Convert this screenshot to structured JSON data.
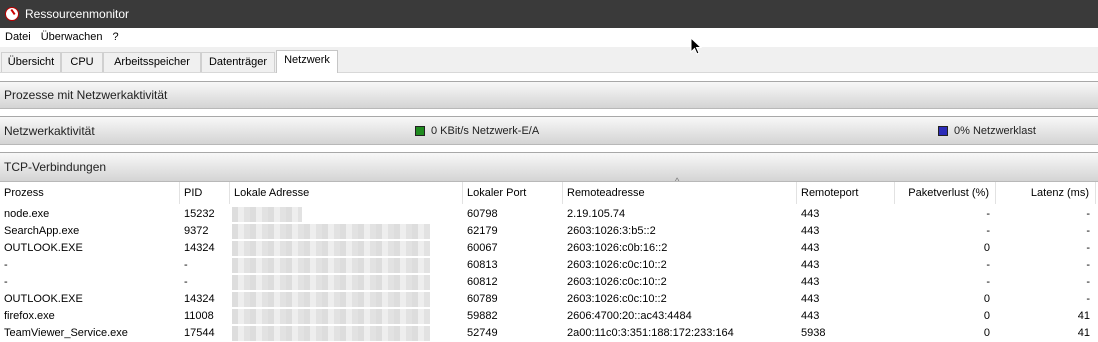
{
  "window": {
    "title": "Ressourcenmonitor",
    "icon": "resmon-gauge-icon"
  },
  "menu": [
    "Datei",
    "Überwachen",
    "?"
  ],
  "tabs": [
    {
      "label": "Übersicht",
      "active": false
    },
    {
      "label": "CPU",
      "active": false
    },
    {
      "label": "Arbeitsspeicher",
      "active": false
    },
    {
      "label": "Datenträger",
      "active": false
    },
    {
      "label": "Netzwerk",
      "active": true
    }
  ],
  "sections": {
    "processes": {
      "title": "Prozesse mit Netzwerkaktivität"
    },
    "activity": {
      "title": "Netzwerkaktivität",
      "io_text": "0 KBit/s Netzwerk-E/A",
      "io_color": "#1f8a1f",
      "load_text": "0% Netzwerklast",
      "load_color": "#2b2bb8"
    },
    "tcp": {
      "title": "TCP-Verbindungen"
    }
  },
  "tcp_table": {
    "columns": [
      "Prozess",
      "PID",
      "Lokale Adresse",
      "Lokaler Port",
      "Remoteadresse",
      "Remoteport",
      "Paketverlust (%)",
      "Latenz (ms)"
    ],
    "sorted_column": "Remoteadresse",
    "rows": [
      {
        "process": "node.exe",
        "pid": "15232",
        "local_port": "60798",
        "remote_address": "2.19.105.74",
        "remote_port": "443",
        "packet_loss": "-",
        "latency": "-"
      },
      {
        "process": "SearchApp.exe",
        "pid": "9372",
        "local_port": "62179",
        "remote_address": "2603:1026:3:b5::2",
        "remote_port": "443",
        "packet_loss": "-",
        "latency": "-"
      },
      {
        "process": "OUTLOOK.EXE",
        "pid": "14324",
        "local_port": "60067",
        "remote_address": "2603:1026:c0b:16::2",
        "remote_port": "443",
        "packet_loss": "0",
        "latency": "-"
      },
      {
        "process": "-",
        "pid": "-",
        "local_port": "60813",
        "remote_address": "2603:1026:c0c:10::2",
        "remote_port": "443",
        "packet_loss": "-",
        "latency": "-"
      },
      {
        "process": "-",
        "pid": "-",
        "local_port": "60812",
        "remote_address": "2603:1026:c0c:10::2",
        "remote_port": "443",
        "packet_loss": "-",
        "latency": "-"
      },
      {
        "process": "OUTLOOK.EXE",
        "pid": "14324",
        "local_port": "60789",
        "remote_address": "2603:1026:c0c:10::2",
        "remote_port": "443",
        "packet_loss": "0",
        "latency": "-"
      },
      {
        "process": "firefox.exe",
        "pid": "11008",
        "local_port": "59882",
        "remote_address": "2606:4700:20::ac43:4484",
        "remote_port": "443",
        "packet_loss": "0",
        "latency": "41"
      },
      {
        "process": "TeamViewer_Service.exe",
        "pid": "17544",
        "local_port": "52749",
        "remote_address": "2a00:11c0:3:351:188:172:233:164",
        "remote_port": "5938",
        "packet_loss": "0",
        "latency": "41"
      }
    ]
  }
}
